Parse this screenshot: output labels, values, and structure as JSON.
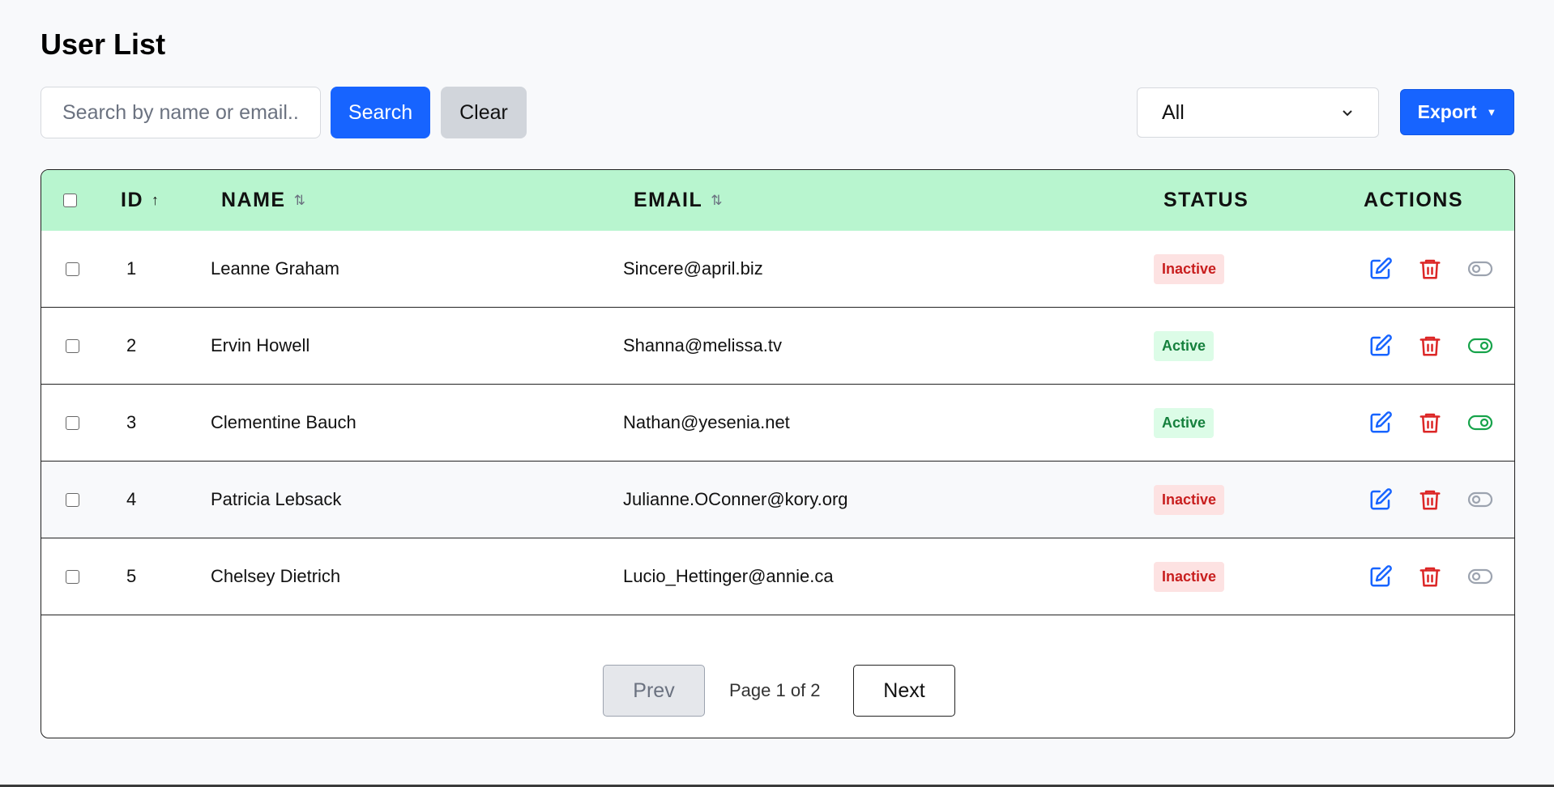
{
  "page": {
    "title": "User List"
  },
  "toolbar": {
    "search_placeholder": "Search by name or email...",
    "search_label": "Search",
    "clear_label": "Clear",
    "filter_selected": "All",
    "export_label": "Export",
    "export_caret": "▼"
  },
  "table": {
    "headers": {
      "id": "ID",
      "id_sort": "↑",
      "name": "NAME",
      "name_sort": "⇅",
      "email": "EMAIL",
      "email_sort": "⇅",
      "status": "STATUS",
      "actions": "ACTIONS"
    },
    "rows": [
      {
        "id": "1",
        "name": "Leanne Graham",
        "email": "Sincere@april.biz",
        "status": "Inactive",
        "active": false
      },
      {
        "id": "2",
        "name": "Ervin Howell",
        "email": "Shanna@melissa.tv",
        "status": "Active",
        "active": true
      },
      {
        "id": "3",
        "name": "Clementine Bauch",
        "email": "Nathan@yesenia.net",
        "status": "Active",
        "active": true
      },
      {
        "id": "4",
        "name": "Patricia Lebsack",
        "email": "Julianne.OConner@kory.org",
        "status": "Inactive",
        "active": false
      },
      {
        "id": "5",
        "name": "Chelsey Dietrich",
        "email": "Lucio_Hettinger@annie.ca",
        "status": "Inactive",
        "active": false
      }
    ]
  },
  "pagination": {
    "prev_label": "Prev",
    "next_label": "Next",
    "info": "Page 1 of 2"
  },
  "colors": {
    "primary": "#1764ff",
    "header_bg": "#b8f5cf",
    "danger": "#dc2626",
    "success": "#16a34a",
    "muted": "#9ca3af"
  },
  "icons": {
    "edit": "edit-icon",
    "delete": "trash-icon",
    "toggle": "toggle-icon"
  }
}
